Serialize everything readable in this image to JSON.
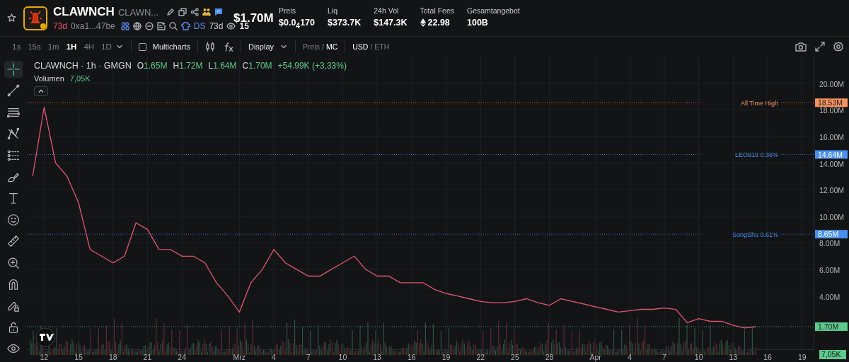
{
  "token": {
    "symbol": "CLAWNCH",
    "name": "CLAWN...",
    "age": "73d",
    "address": "0xa1...47be",
    "ds_label": "DS",
    "ds_age": "73d",
    "watchers": "15",
    "market_cap": "$1.70M"
  },
  "stats": [
    {
      "label": "Preis",
      "value": "$0.0$_{4}$170",
      "kind": "plain"
    },
    {
      "label": "Liq",
      "value": "$373.7K",
      "kind": "plain"
    },
    {
      "label": "24h Vol",
      "value": "$147.3K",
      "kind": "plain"
    },
    {
      "label": "Total Fees",
      "value": "22.98",
      "kind": "eth"
    },
    {
      "label": "Gesamtangebot",
      "value": "100B",
      "kind": "plain"
    }
  ],
  "toolbar": {
    "intervals": [
      {
        "label": "1s",
        "selected": false
      },
      {
        "label": "15s",
        "selected": false
      },
      {
        "label": "1m",
        "selected": false
      },
      {
        "label": "1H",
        "selected": true
      },
      {
        "label": "4H",
        "selected": false
      },
      {
        "label": "1D",
        "selected": false
      }
    ],
    "multicharts": {
      "label": "Multicharts",
      "checked": false
    },
    "display": "Display",
    "price_toggle": {
      "separator": "/",
      "options": [
        {
          "label": "Preis",
          "selected": false
        },
        {
          "label": "MC",
          "selected": true
        }
      ]
    },
    "currency_toggle": {
      "separator": "/",
      "options": [
        {
          "label": "USD",
          "selected": true
        },
        {
          "label": "ETH",
          "selected": false
        }
      ]
    }
  },
  "tools": [
    {
      "kind": "crosshair",
      "selected": true
    },
    {
      "kind": "trendline",
      "selected": false
    },
    {
      "kind": "lines",
      "selected": false
    },
    {
      "kind": "pattern",
      "selected": false
    },
    {
      "kind": "fib",
      "selected": false
    },
    {
      "kind": "brush",
      "selected": false
    },
    {
      "kind": "text",
      "selected": false
    },
    {
      "kind": "emoji",
      "selected": false
    },
    {
      "kind": "ruler",
      "selected": false
    },
    {
      "kind": "zoom",
      "selected": false
    },
    {
      "kind": "magnet",
      "selected": false
    },
    {
      "kind": "lockpen",
      "selected": false
    },
    {
      "kind": "lock",
      "selected": false
    },
    {
      "kind": "eye",
      "selected": false
    }
  ],
  "legend": {
    "title": "CLAWNCH · 1h · GMGN",
    "ohlc": [
      {
        "key": "O",
        "value": "1.65M"
      },
      {
        "key": "H",
        "value": "1.72M"
      },
      {
        "key": "L",
        "value": "1.64M"
      },
      {
        "key": "C",
        "value": "1.70M"
      }
    ],
    "change": "+54.99K (+3,33%)",
    "volume_label": "Volumen",
    "volume_value": "7,05K"
  },
  "chart": {
    "volume_tag": "7,05K",
    "price_tags": [
      {
        "text": "18.53M",
        "color": "#f5925e"
      },
      {
        "text": "14.64M",
        "color": "#4a90f0"
      },
      {
        "text": "8.65M",
        "color": "#4a90f0"
      },
      {
        "text": "1.70M",
        "color": "#5cc98d"
      }
    ],
    "chart_data": {
      "type": "line",
      "grid": true,
      "ylim": [
        0,
        22
      ],
      "categories": [
        null,
        "12",
        null,
        null,
        "15",
        null,
        null,
        "18",
        null,
        null,
        "21",
        null,
        null,
        "24",
        null,
        null,
        null,
        null,
        "Mrz",
        null,
        null,
        "4",
        null,
        null,
        "7",
        null,
        null,
        "10",
        null,
        null,
        "13",
        null,
        null,
        "16",
        null,
        null,
        "19",
        null,
        null,
        "22",
        null,
        null,
        "25",
        null,
        null,
        "28",
        null,
        null,
        null,
        "Apr",
        null,
        null,
        "4",
        null,
        null,
        "7",
        null,
        null,
        "10",
        null,
        null,
        "13",
        null,
        null,
        "16",
        null,
        null,
        "19"
      ],
      "series": [
        {
          "color": "#e0566e",
          "values": [
            13,
            18.2,
            14,
            13,
            11,
            7.5,
            7,
            6.5,
            7,
            9.5,
            9,
            7.5,
            7.5,
            7,
            7,
            6.5,
            5,
            4,
            2.8,
            5,
            6,
            7.5,
            6.5,
            6,
            5.5,
            5.5,
            6,
            6.5,
            7,
            6,
            5.5,
            5.5,
            5,
            5,
            5,
            4.5,
            4.2,
            4,
            3.8,
            3.6,
            3.5,
            3.5,
            3.6,
            3.8,
            3.5,
            3.3,
            3.8,
            3.6,
            3.4,
            3.2,
            3,
            2.8,
            2.9,
            3,
            3,
            3.1,
            3,
            2,
            2.3,
            2.1,
            2.1,
            1.8,
            1.6,
            1.7,
            null,
            null,
            null,
            null
          ]
        }
      ],
      "yticks": [
        {
          "value": 4,
          "label": "4.00M"
        },
        {
          "value": 6,
          "label": "6.00M"
        },
        {
          "value": 8,
          "label": "8.00M"
        },
        {
          "value": 10,
          "label": "10.00M"
        },
        {
          "value": 12,
          "label": "12.00M"
        },
        {
          "value": 14,
          "label": "14.00M"
        },
        {
          "value": 16,
          "label": "16.00M"
        },
        {
          "value": 18,
          "label": "18.00M"
        },
        {
          "value": 20,
          "label": "20.00M"
        }
      ],
      "ref_lines": [
        {
          "axis": "y",
          "value": 18.53,
          "label": "All Time High"
        },
        {
          "axis": "y",
          "value": 14.64,
          "label": "LEO919 0.36%"
        },
        {
          "axis": "y",
          "value": 8.65,
          "label": "SongShu 0.61%"
        },
        {
          "axis": "y",
          "value": 1.7
        }
      ]
    }
  }
}
